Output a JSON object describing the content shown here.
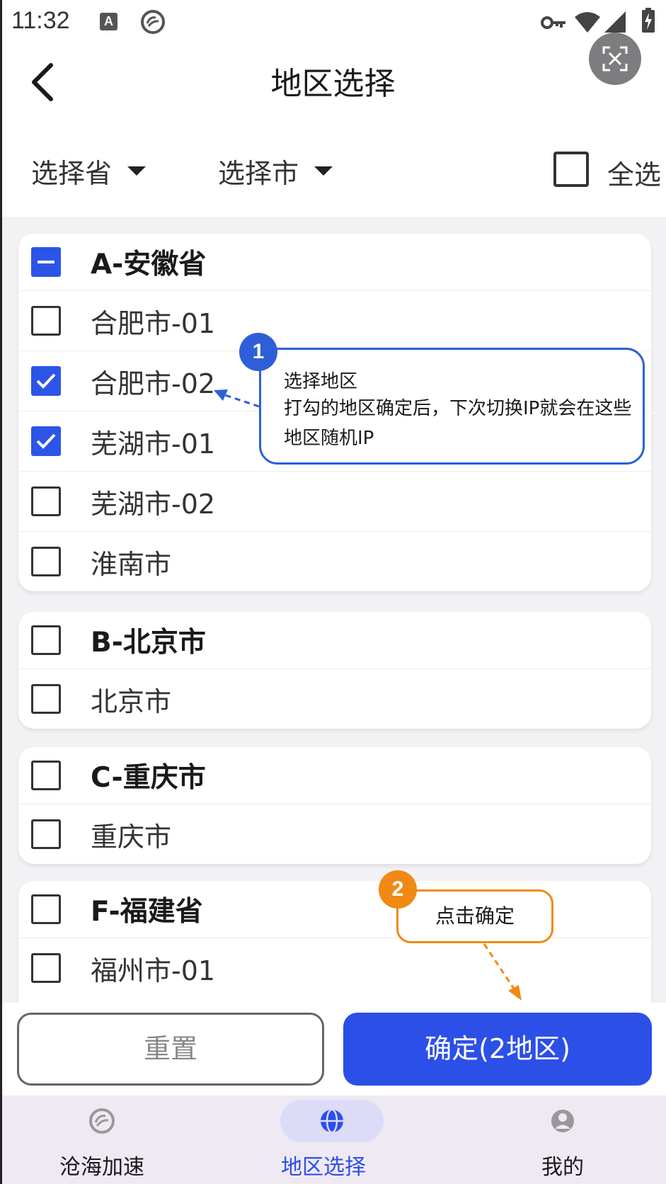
{
  "status_bar": {
    "time": "11:32",
    "a_badge": "A",
    "icons": [
      "app-logo-icon",
      "key-icon",
      "wifi-icon",
      "signal-icon",
      "battery-charging-icon"
    ]
  },
  "header": {
    "title": "地区选择",
    "back_icon": "chevron-left-icon",
    "screenshot_icon": "screenshot-icon"
  },
  "filters": {
    "province_label": "选择省",
    "city_label": "选择市",
    "select_all_label": "全选",
    "select_all_checked": false
  },
  "groups": [
    {
      "title": "A-安徽省",
      "state": "partial",
      "items": [
        {
          "label": "合肥市-01",
          "checked": false
        },
        {
          "label": "合肥市-02",
          "checked": true
        },
        {
          "label": "芜湖市-01",
          "checked": true
        },
        {
          "label": "芜湖市-02",
          "checked": false
        },
        {
          "label": "淮南市",
          "checked": false
        }
      ]
    },
    {
      "title": "B-北京市",
      "state": "unchecked",
      "items": [
        {
          "label": "北京市",
          "checked": false
        }
      ]
    },
    {
      "title": "C-重庆市",
      "state": "unchecked",
      "items": [
        {
          "label": "重庆市",
          "checked": false
        }
      ]
    },
    {
      "title": "F-福建省",
      "state": "unchecked",
      "items": [
        {
          "label": "福州市-01",
          "checked": false
        }
      ]
    }
  ],
  "callouts": {
    "step1": {
      "number": "1",
      "title": "选择地区",
      "text": "打勾的地区确定后，下次切换IP就会在这些地区随机IP"
    },
    "step2": {
      "number": "2",
      "text": "点击确定"
    }
  },
  "actions": {
    "reset_label": "重置",
    "confirm_label": "确定(2地区)"
  },
  "bottom_nav": [
    {
      "label": "沧海加速",
      "icon": "app-logo-icon",
      "active": false
    },
    {
      "label": "地区选择",
      "icon": "globe-icon",
      "active": true
    },
    {
      "label": "我的",
      "icon": "user-icon",
      "active": false
    }
  ],
  "colors": {
    "accent": "#2c4fe8",
    "callout_blue": "#2d5fd8",
    "callout_orange": "#f08a14",
    "nav_bg": "#efe9f3"
  }
}
